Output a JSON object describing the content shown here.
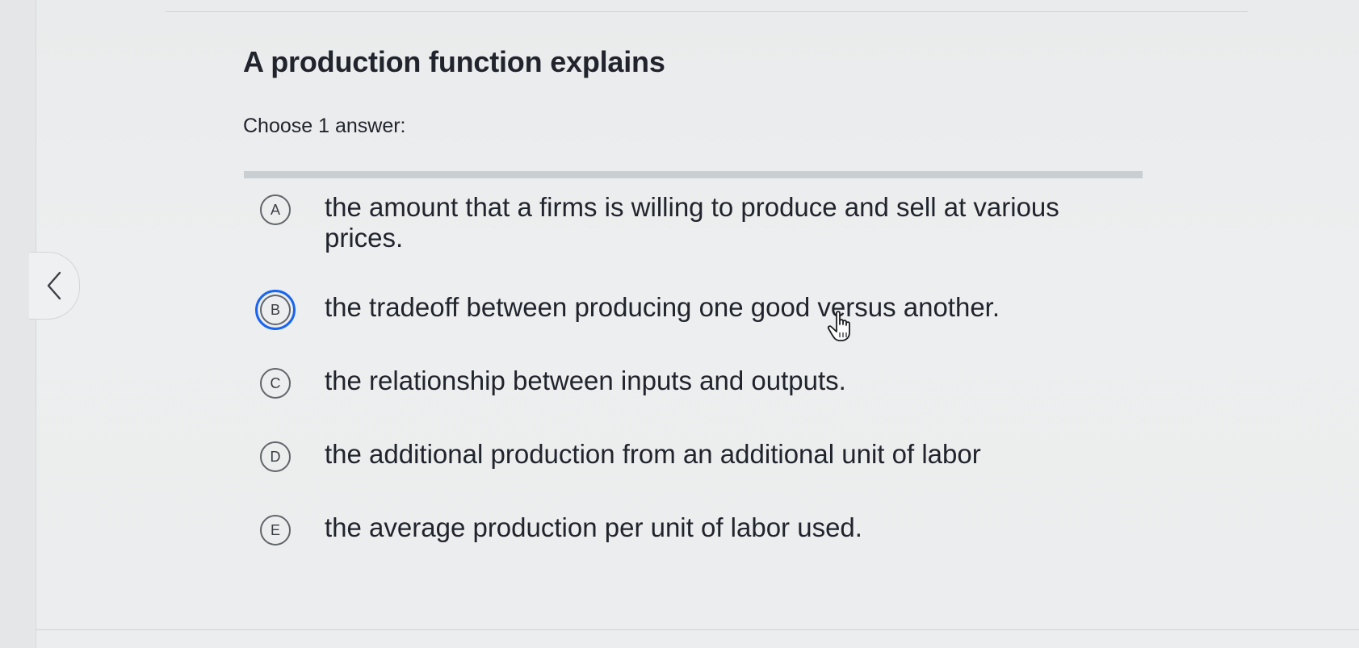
{
  "question": {
    "title": "A production function explains",
    "instruction": "Choose 1 answer:"
  },
  "choices": [
    {
      "letter": "A",
      "text": "the amount that a firms is willing to produce and sell at various prices."
    },
    {
      "letter": "B",
      "text": "the tradeoff between producing one good versus another."
    },
    {
      "letter": "C",
      "text": "the relationship between inputs and outputs."
    },
    {
      "letter": "D",
      "text": "the additional production from an additional unit of labor"
    },
    {
      "letter": "E",
      "text": "the average production per unit of labor used."
    }
  ],
  "selected_choice": "B",
  "navigation": {
    "prev_icon": "chevron-left-icon"
  },
  "colors": {
    "text": "#21242c",
    "selected_ring": "#1865f2",
    "circle_border": "#626569",
    "divider": "#c9ced3",
    "background": "#eceeef"
  },
  "cursor": {
    "icon": "hand-pointer-icon"
  }
}
